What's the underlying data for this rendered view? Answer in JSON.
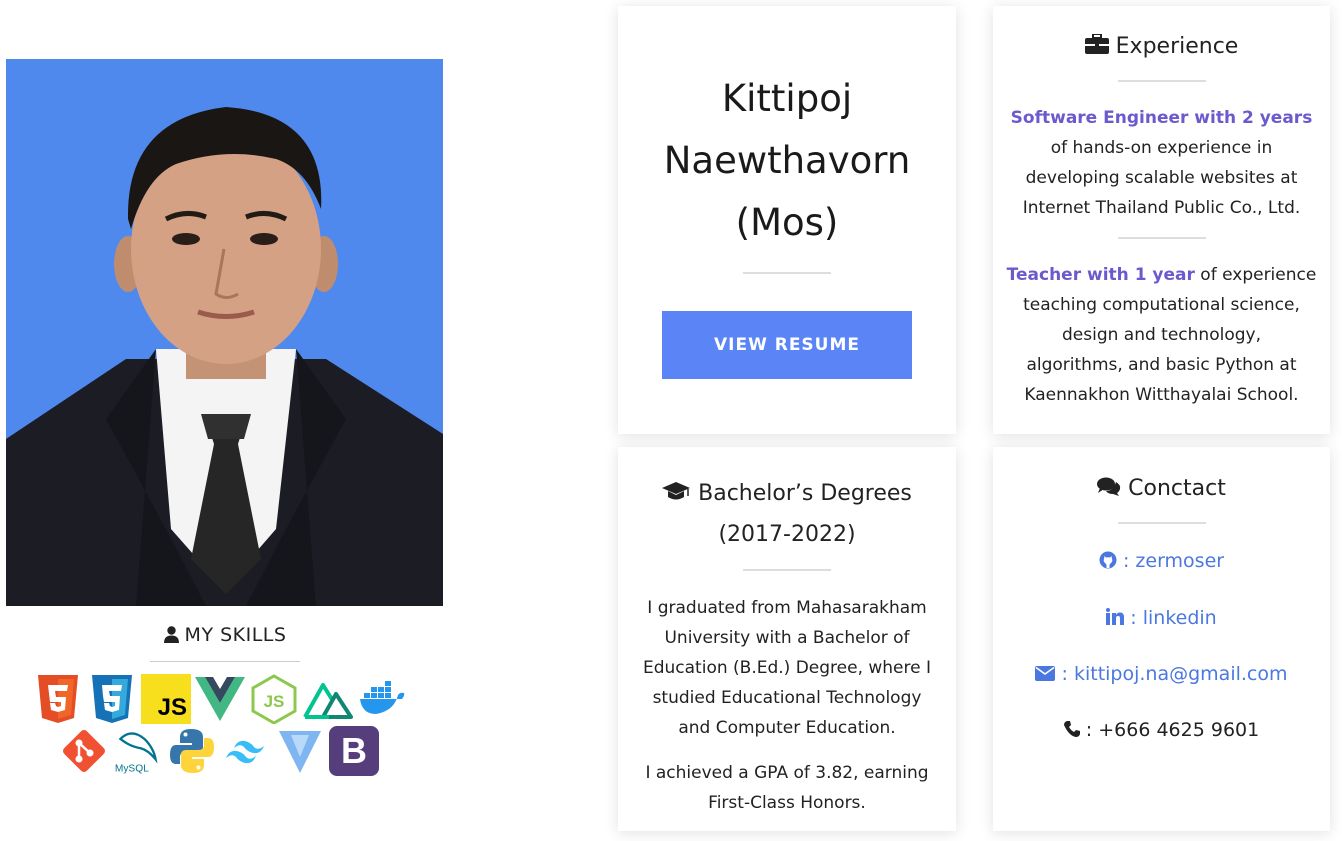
{
  "profile": {
    "name_line1": "Kittipoj",
    "name_line2": "Naewthavorn",
    "name_line3": "(Mos)",
    "resume_button": "VIEW RESUME"
  },
  "skills": {
    "title": "MY SKILLS",
    "row1": [
      {
        "icon": "html5-icon"
      },
      {
        "icon": "css3-icon"
      },
      {
        "icon": "javascript-icon",
        "text": "JS"
      },
      {
        "icon": "vue-icon"
      },
      {
        "icon": "nodejs-icon",
        "text": "JS"
      },
      {
        "icon": "nuxt-icon"
      },
      {
        "icon": "docker-icon"
      }
    ],
    "row2": [
      {
        "icon": "git-icon"
      },
      {
        "icon": "mysql-icon",
        "text": "MySQL"
      },
      {
        "icon": "python-icon"
      },
      {
        "icon": "tailwind-icon"
      },
      {
        "icon": "vite-icon"
      },
      {
        "icon": "bootstrap-icon",
        "text": "B"
      }
    ]
  },
  "experience": {
    "title": "Experience",
    "p1_highlight": "Software Engineer with 2 years",
    "p1_lines": [
      "of hands-on experience in",
      "developing scalable websites at",
      "Internet Thailand Public Co., Ltd."
    ],
    "p2_highlight": "Teacher with 1 year",
    "p2_rest": " of experience",
    "p2_lines": [
      "teaching computational science,",
      "design and technology,",
      "algorithms, and basic Python at",
      "Kaennakhon Witthayalai School."
    ]
  },
  "education": {
    "title": "Bachelor’s Degrees",
    "years": "(2017-2022)",
    "p1_lines": [
      "I graduated from Mahasarakham",
      "University with a Bachelor of",
      "Education (B.Ed.) Degree, where I",
      "studied Educational Technology",
      "and Computer Education."
    ],
    "p2_lines": [
      "I achieved a GPA of 3.82, earning",
      "First-Class Honors."
    ]
  },
  "contact": {
    "title": "Conctact",
    "github": " : zermoser",
    "linkedin": " : linkedin",
    "email": " : kittipoj.na@gmail.com",
    "phone": " : +666 4625 9601"
  },
  "colors": {
    "accent": "#5b85f7",
    "highlight": "#6a5acd",
    "link": "#4a78e0",
    "photo_bg": "#5089ed"
  }
}
